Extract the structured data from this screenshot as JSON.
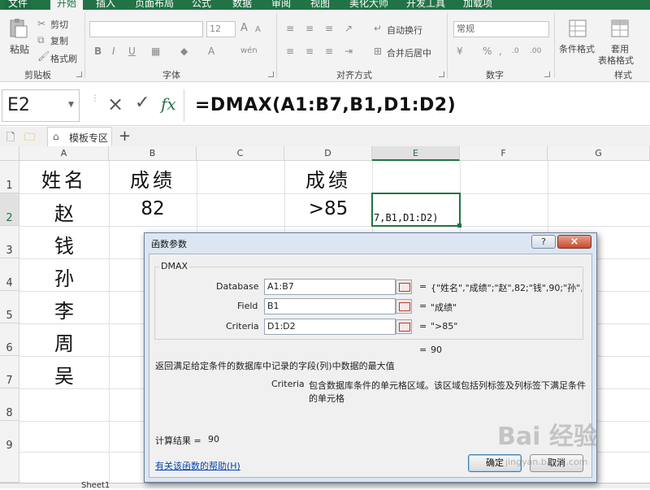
{
  "ribbon": {
    "tabs": [
      "文件",
      "开始",
      "插入",
      "页面布局",
      "公式",
      "数据",
      "审阅",
      "视图",
      "美化大师",
      "开发工具",
      "加载项"
    ],
    "active_tab": "开始",
    "clipboard": {
      "paste": "粘贴",
      "cut": "剪切",
      "copy": "复制",
      "format_painter": "格式刷",
      "group": "剪贴板"
    },
    "font": {
      "font_size": "12",
      "group": "字体",
      "bold": "B",
      "italic": "I",
      "underline": "U"
    },
    "alignment": {
      "wrap_text": "自动换行",
      "merge_center": "合并后居中",
      "group": "对齐方式"
    },
    "number": {
      "format": "常规",
      "group": "数字",
      "percent": "%",
      "comma": ","
    },
    "styles": {
      "conditional": "条件格式",
      "table_format_line1": "套用",
      "table_format_line2": "表格格式",
      "group": "样式"
    }
  },
  "formula_bar": {
    "name_box": "E2",
    "formula": "=DMAX(A1:B7,B1,D1:D2)",
    "cancel_icon": "×",
    "enter_icon": "✓",
    "fx_icon": "fx"
  },
  "sheet_bar": {
    "template_tab": "模板专区",
    "add": "+"
  },
  "grid": {
    "columns": [
      "A",
      "B",
      "C",
      "D",
      "E",
      "F",
      "G"
    ],
    "rows": [
      "1",
      "2",
      "3",
      "4",
      "5",
      "6",
      "7",
      "8",
      "9"
    ],
    "cells": {
      "A1": "姓名",
      "B1": "成绩",
      "D1": "成绩",
      "A2": "赵",
      "B2": "82",
      "D2": ">85",
      "A3": "钱",
      "A4": "孙",
      "A5": "李",
      "A6": "周",
      "A7": "吴",
      "E2": "7,B1,D1:D2)"
    }
  },
  "dialog": {
    "title": "函数参数",
    "help_icon": "?",
    "close_icon": "×",
    "function_name": "DMAX",
    "args": [
      {
        "label": "Database",
        "value": "A1:B7",
        "result": "{\"姓名\",\"成绩\";\"赵\",82;\"钱\",90;\"孙\",..."
      },
      {
        "label": "Field",
        "value": "B1",
        "result": "\"成绩\""
      },
      {
        "label": "Criteria",
        "value": "D1:D2",
        "result": "\">85\""
      }
    ],
    "equals": "=",
    "overall_result": "90",
    "description": "返回满足给定条件的数据库中记录的字段(列)中数据的最大值",
    "param_name": "Criteria",
    "param_desc_line1": "包含数据库条件的单元格区域。该区域包括列标签及列标签下满足条件",
    "param_desc_line2": "的单元格",
    "calc_label": "计算结果 =",
    "calc_value": "90",
    "help_link": "有关该函数的帮助(H)",
    "ok": "确定",
    "cancel": "取消"
  },
  "bottom_tabs": [
    "Sheet1"
  ],
  "watermark": {
    "text": "Bai 经验",
    "url": "jingyan.baidu.com"
  }
}
